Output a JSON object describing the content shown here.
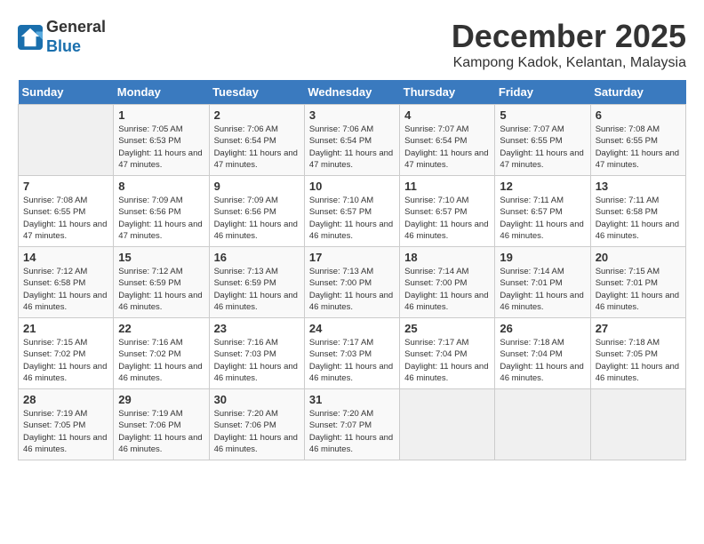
{
  "header": {
    "logo_line1": "General",
    "logo_line2": "Blue",
    "month": "December 2025",
    "location": "Kampong Kadok, Kelantan, Malaysia"
  },
  "days_of_week": [
    "Sunday",
    "Monday",
    "Tuesday",
    "Wednesday",
    "Thursday",
    "Friday",
    "Saturday"
  ],
  "weeks": [
    [
      {
        "day": "",
        "sunrise": "",
        "sunset": "",
        "daylight": ""
      },
      {
        "day": "1",
        "sunrise": "Sunrise: 7:05 AM",
        "sunset": "Sunset: 6:53 PM",
        "daylight": "Daylight: 11 hours and 47 minutes."
      },
      {
        "day": "2",
        "sunrise": "Sunrise: 7:06 AM",
        "sunset": "Sunset: 6:54 PM",
        "daylight": "Daylight: 11 hours and 47 minutes."
      },
      {
        "day": "3",
        "sunrise": "Sunrise: 7:06 AM",
        "sunset": "Sunset: 6:54 PM",
        "daylight": "Daylight: 11 hours and 47 minutes."
      },
      {
        "day": "4",
        "sunrise": "Sunrise: 7:07 AM",
        "sunset": "Sunset: 6:54 PM",
        "daylight": "Daylight: 11 hours and 47 minutes."
      },
      {
        "day": "5",
        "sunrise": "Sunrise: 7:07 AM",
        "sunset": "Sunset: 6:55 PM",
        "daylight": "Daylight: 11 hours and 47 minutes."
      },
      {
        "day": "6",
        "sunrise": "Sunrise: 7:08 AM",
        "sunset": "Sunset: 6:55 PM",
        "daylight": "Daylight: 11 hours and 47 minutes."
      }
    ],
    [
      {
        "day": "7",
        "sunrise": "Sunrise: 7:08 AM",
        "sunset": "Sunset: 6:55 PM",
        "daylight": "Daylight: 11 hours and 47 minutes."
      },
      {
        "day": "8",
        "sunrise": "Sunrise: 7:09 AM",
        "sunset": "Sunset: 6:56 PM",
        "daylight": "Daylight: 11 hours and 47 minutes."
      },
      {
        "day": "9",
        "sunrise": "Sunrise: 7:09 AM",
        "sunset": "Sunset: 6:56 PM",
        "daylight": "Daylight: 11 hours and 46 minutes."
      },
      {
        "day": "10",
        "sunrise": "Sunrise: 7:10 AM",
        "sunset": "Sunset: 6:57 PM",
        "daylight": "Daylight: 11 hours and 46 minutes."
      },
      {
        "day": "11",
        "sunrise": "Sunrise: 7:10 AM",
        "sunset": "Sunset: 6:57 PM",
        "daylight": "Daylight: 11 hours and 46 minutes."
      },
      {
        "day": "12",
        "sunrise": "Sunrise: 7:11 AM",
        "sunset": "Sunset: 6:57 PM",
        "daylight": "Daylight: 11 hours and 46 minutes."
      },
      {
        "day": "13",
        "sunrise": "Sunrise: 7:11 AM",
        "sunset": "Sunset: 6:58 PM",
        "daylight": "Daylight: 11 hours and 46 minutes."
      }
    ],
    [
      {
        "day": "14",
        "sunrise": "Sunrise: 7:12 AM",
        "sunset": "Sunset: 6:58 PM",
        "daylight": "Daylight: 11 hours and 46 minutes."
      },
      {
        "day": "15",
        "sunrise": "Sunrise: 7:12 AM",
        "sunset": "Sunset: 6:59 PM",
        "daylight": "Daylight: 11 hours and 46 minutes."
      },
      {
        "day": "16",
        "sunrise": "Sunrise: 7:13 AM",
        "sunset": "Sunset: 6:59 PM",
        "daylight": "Daylight: 11 hours and 46 minutes."
      },
      {
        "day": "17",
        "sunrise": "Sunrise: 7:13 AM",
        "sunset": "Sunset: 7:00 PM",
        "daylight": "Daylight: 11 hours and 46 minutes."
      },
      {
        "day": "18",
        "sunrise": "Sunrise: 7:14 AM",
        "sunset": "Sunset: 7:00 PM",
        "daylight": "Daylight: 11 hours and 46 minutes."
      },
      {
        "day": "19",
        "sunrise": "Sunrise: 7:14 AM",
        "sunset": "Sunset: 7:01 PM",
        "daylight": "Daylight: 11 hours and 46 minutes."
      },
      {
        "day": "20",
        "sunrise": "Sunrise: 7:15 AM",
        "sunset": "Sunset: 7:01 PM",
        "daylight": "Daylight: 11 hours and 46 minutes."
      }
    ],
    [
      {
        "day": "21",
        "sunrise": "Sunrise: 7:15 AM",
        "sunset": "Sunset: 7:02 PM",
        "daylight": "Daylight: 11 hours and 46 minutes."
      },
      {
        "day": "22",
        "sunrise": "Sunrise: 7:16 AM",
        "sunset": "Sunset: 7:02 PM",
        "daylight": "Daylight: 11 hours and 46 minutes."
      },
      {
        "day": "23",
        "sunrise": "Sunrise: 7:16 AM",
        "sunset": "Sunset: 7:03 PM",
        "daylight": "Daylight: 11 hours and 46 minutes."
      },
      {
        "day": "24",
        "sunrise": "Sunrise: 7:17 AM",
        "sunset": "Sunset: 7:03 PM",
        "daylight": "Daylight: 11 hours and 46 minutes."
      },
      {
        "day": "25",
        "sunrise": "Sunrise: 7:17 AM",
        "sunset": "Sunset: 7:04 PM",
        "daylight": "Daylight: 11 hours and 46 minutes."
      },
      {
        "day": "26",
        "sunrise": "Sunrise: 7:18 AM",
        "sunset": "Sunset: 7:04 PM",
        "daylight": "Daylight: 11 hours and 46 minutes."
      },
      {
        "day": "27",
        "sunrise": "Sunrise: 7:18 AM",
        "sunset": "Sunset: 7:05 PM",
        "daylight": "Daylight: 11 hours and 46 minutes."
      }
    ],
    [
      {
        "day": "28",
        "sunrise": "Sunrise: 7:19 AM",
        "sunset": "Sunset: 7:05 PM",
        "daylight": "Daylight: 11 hours and 46 minutes."
      },
      {
        "day": "29",
        "sunrise": "Sunrise: 7:19 AM",
        "sunset": "Sunset: 7:06 PM",
        "daylight": "Daylight: 11 hours and 46 minutes."
      },
      {
        "day": "30",
        "sunrise": "Sunrise: 7:20 AM",
        "sunset": "Sunset: 7:06 PM",
        "daylight": "Daylight: 11 hours and 46 minutes."
      },
      {
        "day": "31",
        "sunrise": "Sunrise: 7:20 AM",
        "sunset": "Sunset: 7:07 PM",
        "daylight": "Daylight: 11 hours and 46 minutes."
      },
      {
        "day": "",
        "sunrise": "",
        "sunset": "",
        "daylight": ""
      },
      {
        "day": "",
        "sunrise": "",
        "sunset": "",
        "daylight": ""
      },
      {
        "day": "",
        "sunrise": "",
        "sunset": "",
        "daylight": ""
      }
    ]
  ]
}
